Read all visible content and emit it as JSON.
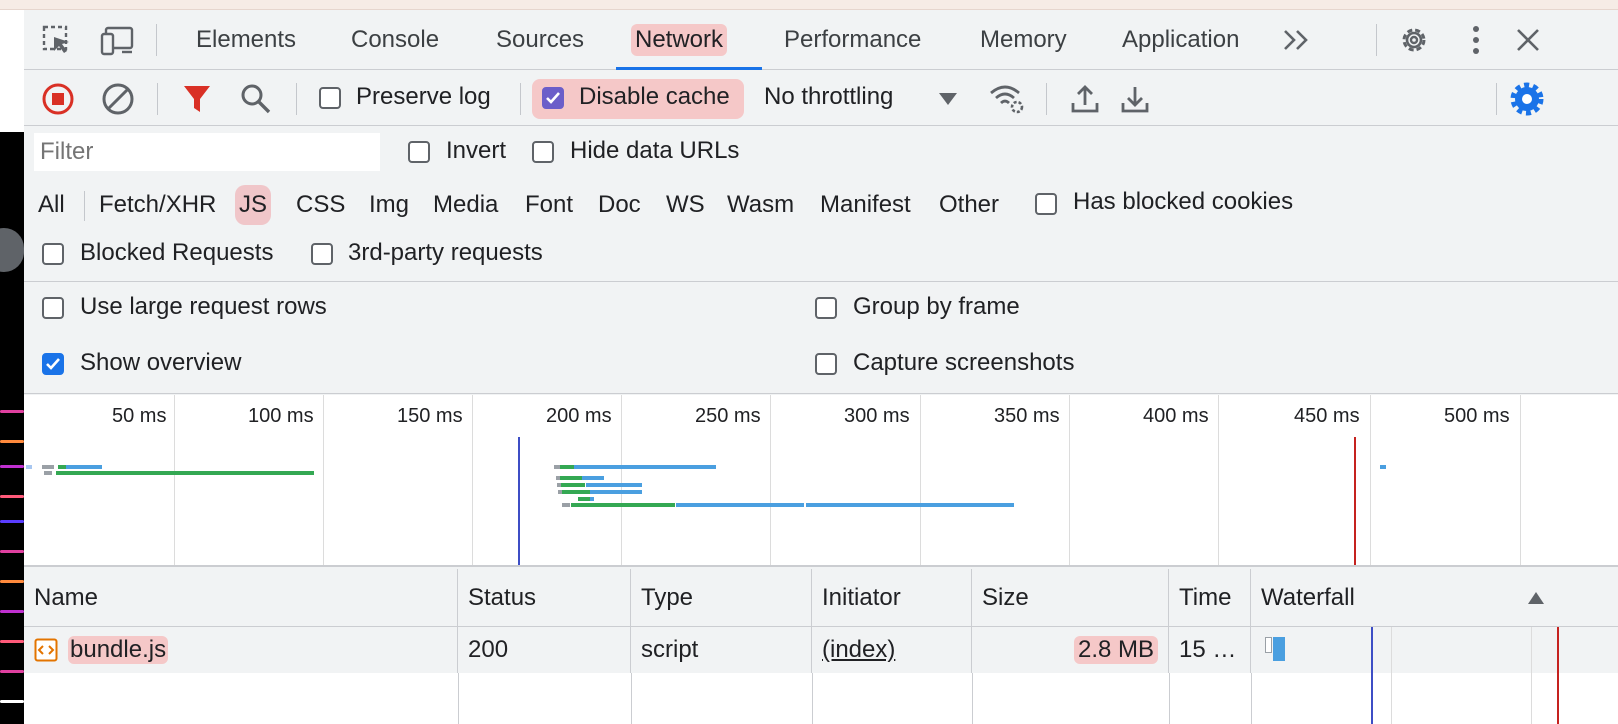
{
  "tabs": [
    {
      "label": "Elements"
    },
    {
      "label": "Console"
    },
    {
      "label": "Sources"
    },
    {
      "label": "Network",
      "active": true
    },
    {
      "label": "Performance"
    },
    {
      "label": "Memory"
    },
    {
      "label": "Application"
    }
  ],
  "toolbar": {
    "preserve_log": "Preserve log",
    "disable_cache": "Disable cache",
    "throttling": "No throttling"
  },
  "filter": {
    "placeholder": "Filter",
    "invert": "Invert",
    "hide_data_urls": "Hide data URLs",
    "types": [
      "All",
      "Fetch/XHR",
      "JS",
      "CSS",
      "Img",
      "Media",
      "Font",
      "Doc",
      "WS",
      "Wasm",
      "Manifest",
      "Other"
    ],
    "selected_type": "JS",
    "has_blocked_cookies": "Has blocked cookies",
    "blocked_requests": "Blocked Requests",
    "third_party": "3rd-party requests"
  },
  "settings": {
    "large_rows": "Use large request rows",
    "group_by_frame": "Group by frame",
    "show_overview": "Show overview",
    "show_overview_checked": true,
    "capture_screenshots": "Capture screenshots"
  },
  "overview": {
    "ticks": [
      "50 ms",
      "100 ms",
      "150 ms",
      "200 ms",
      "250 ms",
      "300 ms",
      "350 ms",
      "400 ms",
      "450 ms",
      "500 ms"
    ]
  },
  "table": {
    "headers": [
      "Name",
      "Status",
      "Type",
      "Initiator",
      "Size",
      "Time",
      "Waterfall"
    ],
    "rows": [
      {
        "name": "bundle.js",
        "status": "200",
        "type": "script",
        "initiator": "(index)",
        "size": "2.8 MB",
        "time": "15 …"
      }
    ]
  },
  "colors": {
    "accent": "#1a73e8",
    "record_red": "#d93025",
    "highlight": "#f5c8c8",
    "bar_green": "#34a853",
    "bar_blue": "#4a9fe0"
  }
}
